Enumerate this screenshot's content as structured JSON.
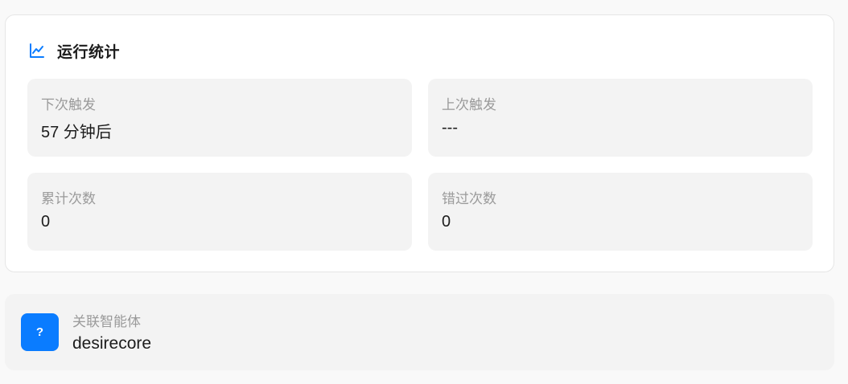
{
  "stats": {
    "title": "运行统计",
    "icon": "line-chart-icon",
    "accent_color": "#0a7cff",
    "next_trigger": {
      "label": "下次触发",
      "value": "57 分钟后"
    },
    "last_trigger": {
      "label": "上次触发",
      "value": "---"
    },
    "total_count": {
      "label": "累计次数",
      "value": "0"
    },
    "missed_count": {
      "label": "错过次数",
      "value": "0"
    }
  },
  "agent": {
    "label": "关联智能体",
    "name": "desirecore",
    "avatar_glyph": "?",
    "avatar_color": "#0a7cff"
  }
}
